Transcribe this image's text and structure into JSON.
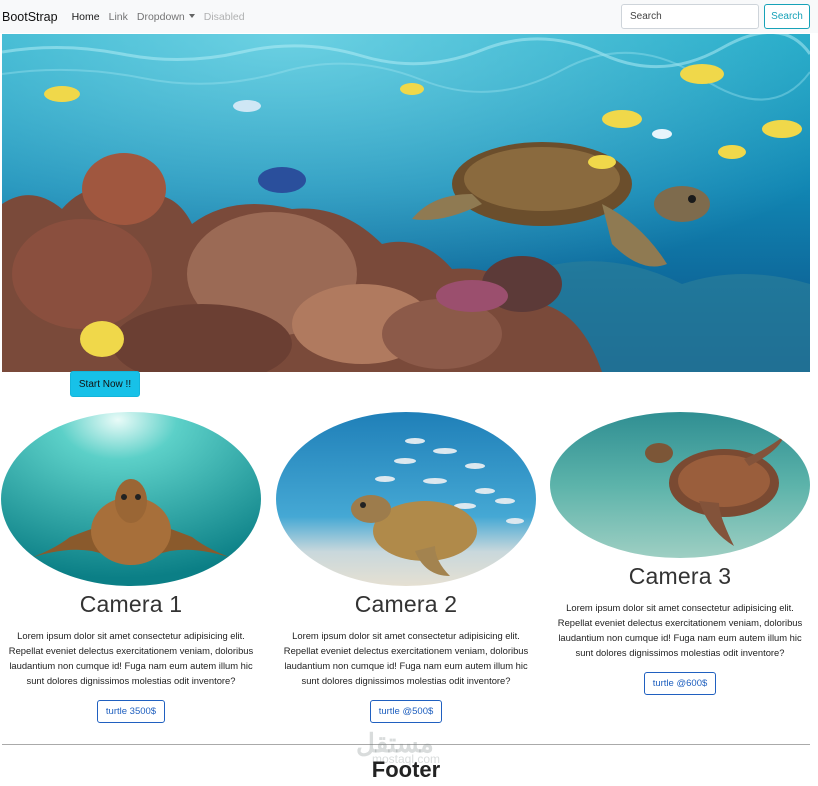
{
  "navbar": {
    "brand": "BootStrap",
    "links": [
      {
        "label": "Home"
      },
      {
        "label": "Link"
      },
      {
        "label": "Dropdown"
      },
      {
        "label": "Disabled"
      }
    ],
    "search": {
      "placeholder": "Search",
      "button_label": "Search"
    }
  },
  "hero": {
    "image": "underwater-coral-reef-turtle",
    "button_label": "Start Now !!"
  },
  "cards": [
    {
      "image": "turtle-swimming-toward-viewer",
      "title": "Camera 1",
      "text": "Lorem ipsum dolor sit amet consectetur adipisicing elit. Repellat eveniet delectus exercitationem veniam, doloribus laudantium non cumque id! Fuga nam eum autem illum hic sunt dolores dignissimos molestias odit inventore?",
      "button_label": "turtle 3500$"
    },
    {
      "image": "turtle-with-school-of-fish",
      "title": "Camera 2",
      "text": "Lorem ipsum dolor sit amet consectetur adipisicing elit. Repellat eveniet delectus exercitationem veniam, doloribus laudantium non cumque id! Fuga nam eum autem illum hic sunt dolores dignissimos molestias odit inventore?",
      "button_label": "turtle @500$"
    },
    {
      "image": "turtle-over-sandy-seabed",
      "title": "Camera 3",
      "text": "Lorem ipsum dolor sit amet consectetur adipisicing elit. Repellat eveniet delectus exercitationem veniam, doloribus laudantium non cumque id! Fuga nam eum autem illum hic sunt dolores dignissimos molestias odit inventore?",
      "button_label": "turtle @600$"
    }
  ],
  "footer": {
    "title": "Footer"
  },
  "watermark": {
    "text": "مستقل",
    "sub": "mostaql.com"
  },
  "colors": {
    "info": "#17a2b8",
    "primary_outline": "#1e5fbf",
    "navbar_bg": "#f8f9fa"
  }
}
